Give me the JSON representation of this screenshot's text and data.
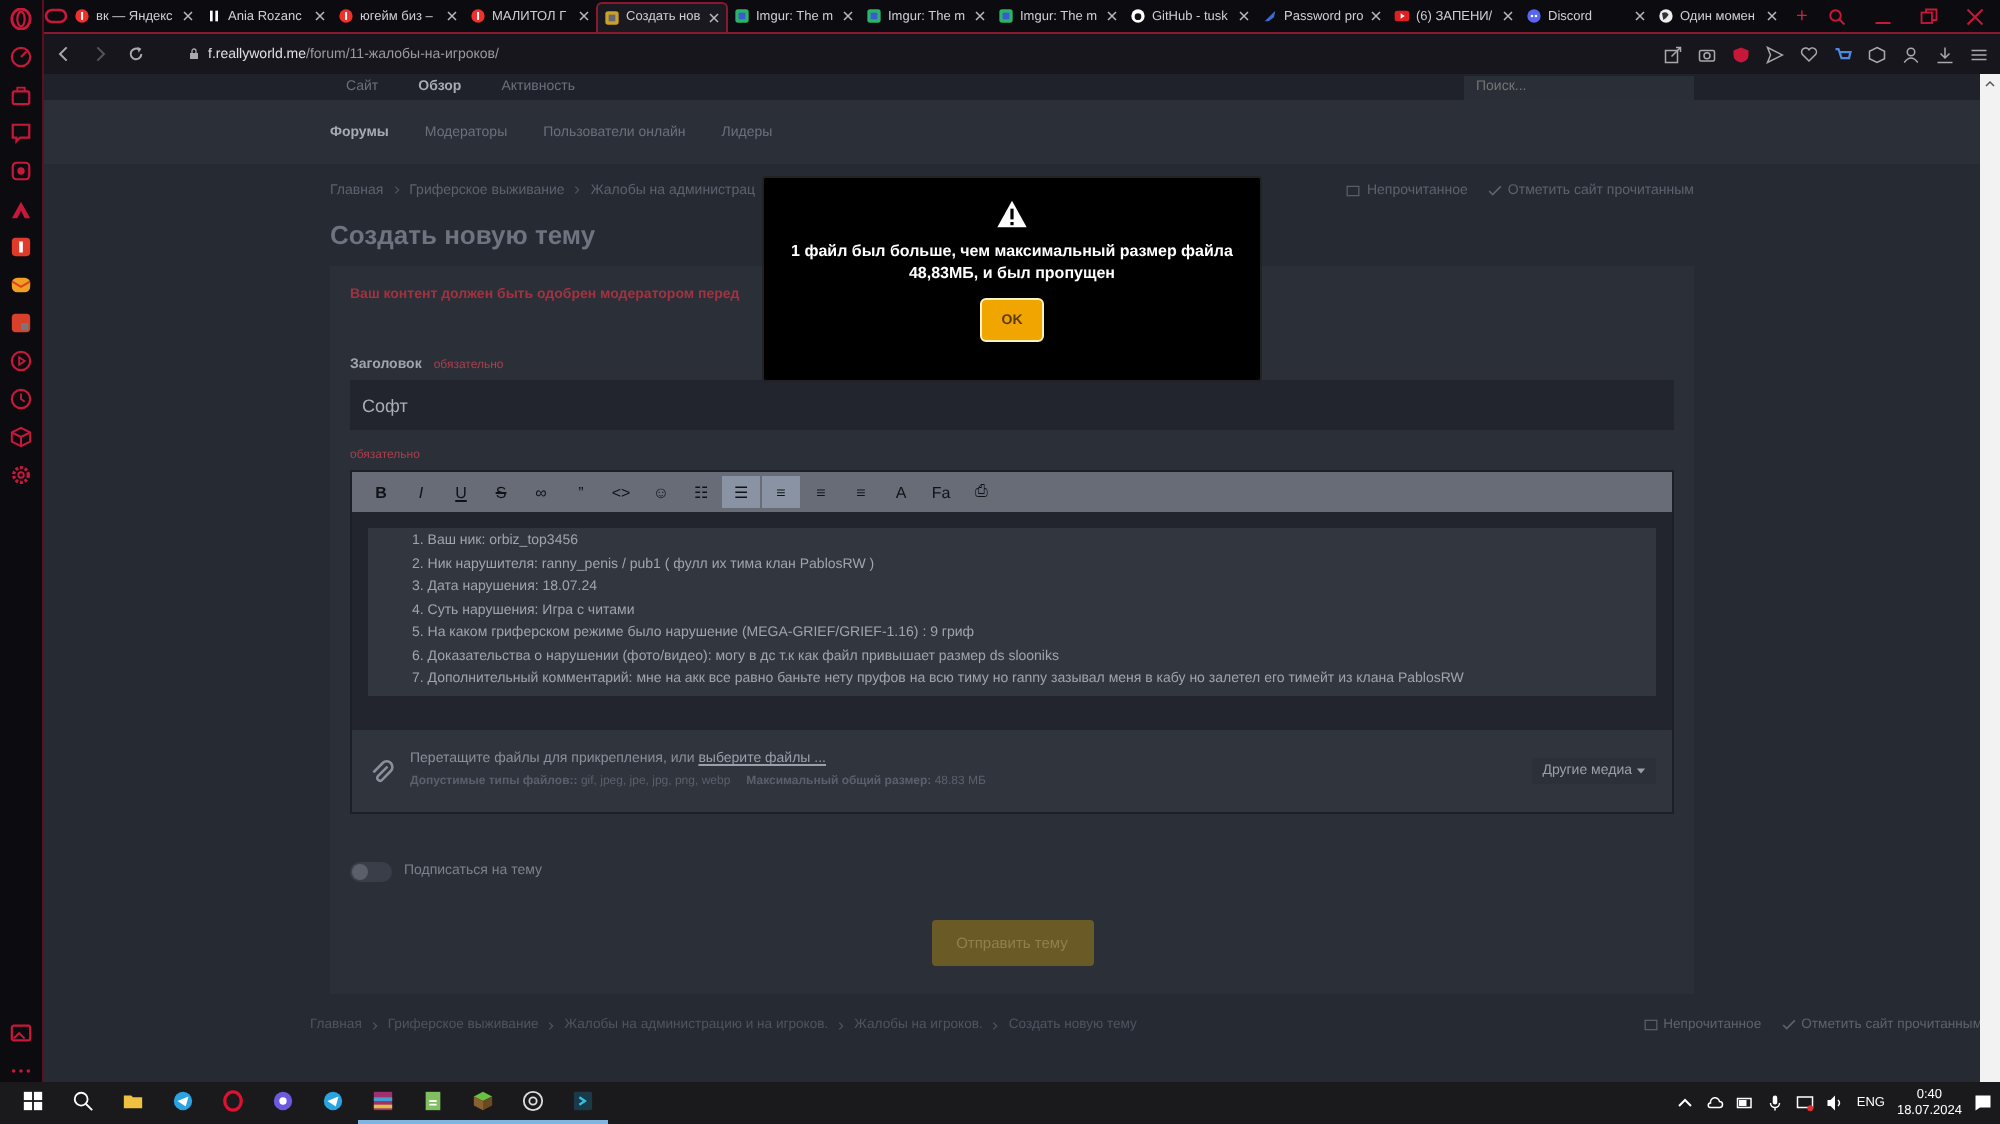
{
  "browser": {
    "tabs": [
      {
        "title": "вк — Яндекс",
        "selected": false
      },
      {
        "title": "Ania Rozanс",
        "selected": false
      },
      {
        "title": "югейм биз –",
        "selected": false
      },
      {
        "title": "МАЛИТОЛ Г",
        "selected": false
      },
      {
        "title": "Создать нов",
        "selected": true
      },
      {
        "title": "Imgur: The m",
        "selected": false
      },
      {
        "title": "Imgur: The m",
        "selected": false
      },
      {
        "title": "Imgur: The m",
        "selected": false
      },
      {
        "title": "GitHub - tusk",
        "selected": false
      },
      {
        "title": "Password pro",
        "selected": false
      },
      {
        "title": "(6) ЗАПЕНИ/",
        "selected": false
      },
      {
        "title": "Discord",
        "selected": false
      },
      {
        "title": "Один момен",
        "selected": false
      }
    ],
    "new_tab": "+",
    "address": {
      "domain": "f.reallyworld.me",
      "path": "/forum/11-жалобы-на-игроков/"
    }
  },
  "page": {
    "top_nav": [
      {
        "label": "Сайт",
        "selected": false
      },
      {
        "label": "Обзор",
        "selected": true
      },
      {
        "label": "Активность",
        "selected": false
      }
    ],
    "search": {
      "placeholder": "Поиск..."
    },
    "sub_nav": [
      {
        "label": "Форумы",
        "selected": true
      },
      {
        "label": "Модераторы",
        "selected": false
      },
      {
        "label": "Пользователи онлайн",
        "selected": false
      },
      {
        "label": "Лидеры",
        "selected": false
      }
    ],
    "breadcrumb": [
      "Главная",
      "Гриферское выживание",
      "Жалобы на администрац"
    ],
    "actions": [
      "Непрочитанное",
      "Отметить сайт прочитанным"
    ],
    "title": "Создать новую тему",
    "notice": "Ваш контент должен быть одобрен модератором перед",
    "form": {
      "title_label": "Заголовок",
      "title_hint": "обязательно",
      "title_value": "Софт",
      "message_hint": "обязательно",
      "toolbar": [
        {
          "glyph": "B",
          "selected": false
        },
        {
          "glyph": "I",
          "selected": false
        },
        {
          "glyph": "U",
          "selected": false
        },
        {
          "glyph": "S",
          "selected": false
        },
        {
          "glyph": "∞",
          "selected": false
        },
        {
          "glyph": "”",
          "selected": false
        },
        {
          "glyph": "<>",
          "selected": false
        },
        {
          "glyph": "☺",
          "selected": false
        },
        {
          "glyph": "☷",
          "selected": false
        },
        {
          "glyph": "☰",
          "selected": true
        },
        {
          "glyph": "≡",
          "selected": true
        },
        {
          "glyph": "≡",
          "selected": false
        },
        {
          "glyph": "≡",
          "selected": false
        },
        {
          "glyph": "A",
          "selected": false
        },
        {
          "glyph": "Fa",
          "selected": false
        },
        {
          "glyph": "⎙",
          "selected": false
        }
      ],
      "message_lines": [
        "1. Ваш ник: orbiz_top3456",
        "2. Ник нарушителя: ranny_penis / pub1 ( фулл их тима клан PablosRW )",
        "3. Дата нарушения: 18.07.24",
        "4. Суть нарушения: Игра с читами",
        "5. На каком гриферском режиме было нарушение (MEGA-GRIEF/GRIEF-1.16) : 9 гриф",
        "6. Доказательства о нарушении (фото/видео): могу в дс т.к как файл привышает размер ds slooniks",
        "7. Дополнительный комментарий: мне на акк все равно баньте нету пруфов на всю тиму но ranny зазывал меня в кабу но залетел его тимейт  из клана PablosRW"
      ],
      "attach": {
        "text": "Перетащите файлы для прикрепления, или ",
        "link": "выберите файлы ...",
        "types_label": "Допустимые типы файлов::",
        "types": "gif, jpeg, jpe, jpg, png, webp",
        "size_label": "Максимальный общий размер:",
        "size": "48.83 МБ",
        "more_media": "Другие медиа"
      },
      "subscribe": {
        "label": "Подписаться на тему",
        "on": false
      },
      "submit": "Отправить тему"
    },
    "footer_breadcrumb": [
      "Главная",
      "Гриферское выживание",
      "Жалобы на администрацию и на игроков.",
      "Жалобы на игроков.",
      "Создать новую тему"
    ],
    "footer_actions": [
      "Непрочитанное",
      "Отметить сайт прочитанным"
    ]
  },
  "dialog": {
    "message": "1 файл был больше, чем максимальный размер файла 48,83МБ, и был пропущен",
    "button": "OK"
  },
  "taskbar": {
    "lang": "ENG",
    "time": "0:40",
    "date": "18.07.2024"
  }
}
